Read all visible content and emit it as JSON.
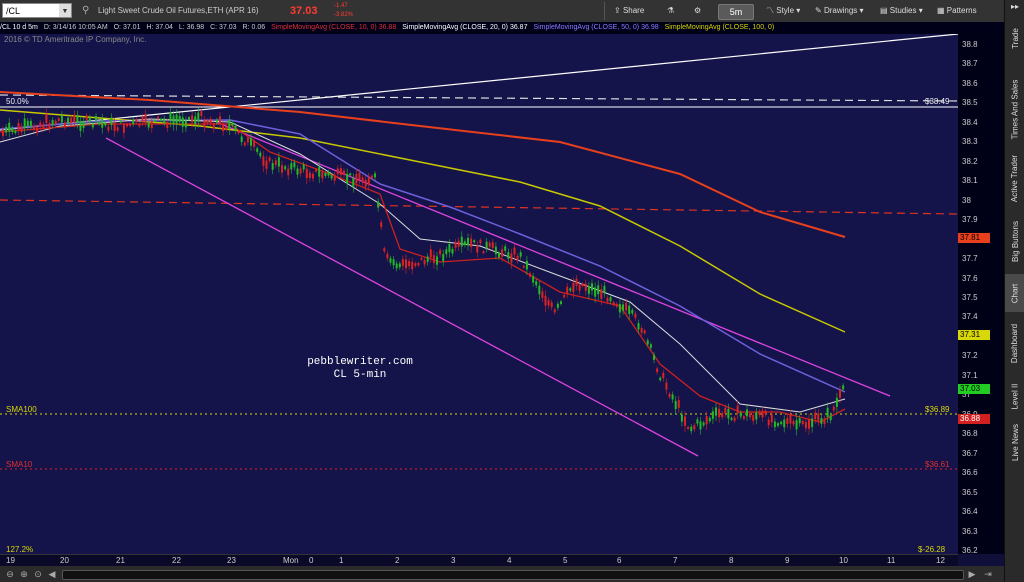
{
  "toolbar": {
    "symbol": "/CL",
    "description": "Light Sweet Crude Oil Futures,ETH (APR 16)",
    "last_price": "37.03",
    "change": "-1.47",
    "change_pct": "-3.82%",
    "share_label": "Share",
    "timeframe": "5m",
    "style_label": "Style",
    "drawings_label": "Drawings",
    "studies_label": "Studies",
    "patterns_label": "Patterns"
  },
  "status": {
    "title": "/CL 10 d 5m",
    "date": "D: 3/14/16 10:05 AM",
    "open": "O: 37.01",
    "high": "H: 37.04",
    "low": "L: 36.98",
    "close": "C: 37.03",
    "r": "R: 0.06",
    "sma10": "SimpleMovingAvg (CLOSE, 10, 0)",
    "sma10_val": "36.88",
    "sma20": "SimpleMovingAvg (CLOSE, 20, 0)",
    "sma20_val": "36.87",
    "sma50": "SimpleMovingAvg (CLOSE, 50, 0)",
    "sma50_val": "36.98",
    "sma100": "SimpleMovingAvg (CLOSE, 100, 0)",
    "copyright": "2016 © TD Ameritrade IP Company, Inc."
  },
  "plot_labels": {
    "fib_top": "50.0%",
    "fib_top_value": "$38.49",
    "sma100_line": "SMA100",
    "sma100_value": "$36.89",
    "sma10_line": "SMA10",
    "sma10_value": "$36.61",
    "fib_bottom": "127.2%",
    "fib_bottom_value": "$-26.28",
    "watermark_site": "pebblewriter.com",
    "watermark_desc": "CL 5-min"
  },
  "price_axis": {
    "ticks": [
      "38.8",
      "38.7",
      "38.6",
      "38.5",
      "38.4",
      "38.3",
      "38.2",
      "38.1",
      "38",
      "37.9",
      "37.8",
      "37.7",
      "37.6",
      "37.5",
      "37.4",
      "37.3",
      "37.2",
      "37.1",
      "37",
      "36.9",
      "36.8",
      "36.7",
      "36.6",
      "36.5",
      "36.4",
      "36.3",
      "36.2"
    ],
    "badges": [
      {
        "label": "37.81",
        "color": "#e8401c",
        "text_color": "#000",
        "price": 37.81
      },
      {
        "label": "37.31",
        "color": "#d7d70a",
        "text_color": "#000",
        "price": 37.31
      },
      {
        "label": "37.03",
        "color": "#22cc22",
        "text_color": "#000",
        "price": 37.03
      },
      {
        "label": "36.88",
        "color": "#d12020",
        "text_color": "#fff",
        "price": 36.88
      }
    ]
  },
  "time_axis": {
    "ticks": [
      "19",
      "20",
      "21",
      "22",
      "23",
      "Mon",
      "0",
      "1",
      "2",
      "3",
      "4",
      "5",
      "6",
      "7",
      "8",
      "9",
      "10",
      "11",
      "12"
    ]
  },
  "side_tabs": [
    "Trade",
    "Times And Sales",
    "Active Trader",
    "Big Buttons",
    "Chart",
    "Dashboard",
    "Level II",
    "Live News"
  ],
  "colors": {
    "sma10": "#cc2020",
    "sma20": "#dddddd",
    "sma50": "#6f5fdd",
    "sma100": "#c8c800",
    "sma200": "#e8401c",
    "channel": "#dd44dd",
    "up_candle": "#22bb22",
    "down_candle": "#dd2222"
  }
}
